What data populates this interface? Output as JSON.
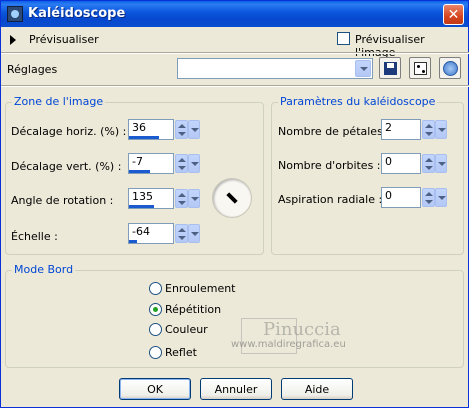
{
  "window": {
    "title": "Kaléidoscope"
  },
  "preview": {
    "label": "Prévisualiser",
    "checkbox_label": "Prévisualiser l'image",
    "checked": false
  },
  "presets": {
    "label": "Réglages",
    "value": ""
  },
  "image_zone": {
    "title": "Zone de l'image",
    "fields": [
      {
        "label": "Décalage horiz. (%) :",
        "value": "36",
        "fill": 0.68
      },
      {
        "label": "Décalage vert. (%) :",
        "value": "-7",
        "fill": 0.47
      },
      {
        "label": "Angle de rotation :",
        "value": "135",
        "fill": 0.55
      },
      {
        "label": "Échelle :",
        "value": "-64",
        "fill": 0.18
      }
    ]
  },
  "kaleido": {
    "title": "Paramètres du kaléidoscope",
    "fields": [
      {
        "label": "Nombre de pétales :",
        "value": "2"
      },
      {
        "label": "Nombre d'orbites :",
        "value": "0"
      },
      {
        "label": "Aspiration radiale :",
        "value": "0"
      }
    ]
  },
  "edge_mode": {
    "title": "Mode Bord",
    "options": [
      {
        "label": "Enroulement",
        "checked": false
      },
      {
        "label": "Répétition",
        "checked": true
      },
      {
        "label": "Couleur",
        "checked": false
      },
      {
        "label": "Reflet",
        "checked": false
      }
    ]
  },
  "watermark": {
    "name": "Pinuccia",
    "url": "www.maldiregrafica.eu"
  },
  "buttons": {
    "ok": "OK",
    "cancel": "Annuler",
    "help": "Aide"
  },
  "colors": {
    "titlebar": "#0a55dc",
    "group_title": "#0046d5",
    "window_bg": "#ece9d8"
  }
}
